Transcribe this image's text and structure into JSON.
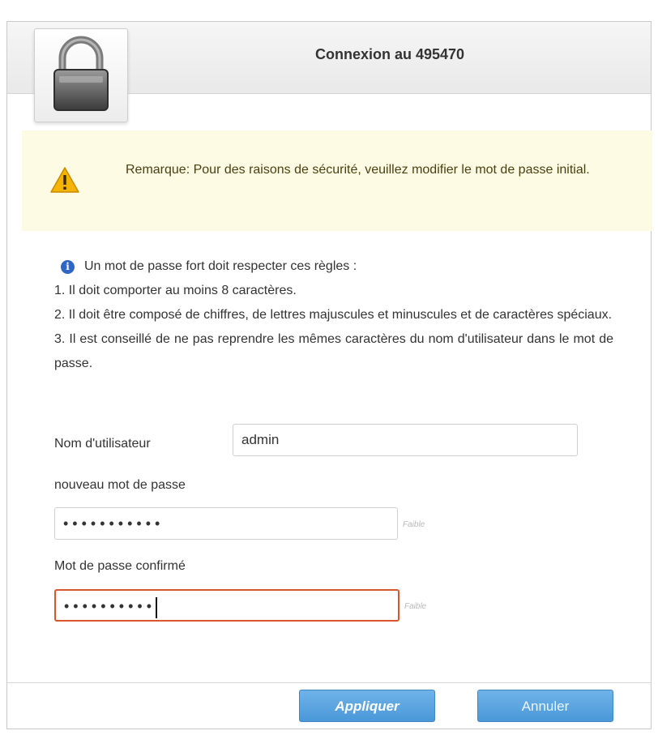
{
  "dialog": {
    "title": "Connexion au 495470"
  },
  "notice": {
    "text": "Remarque: Pour des raisons de sécurité, veuillez modifier le mot de passe initial."
  },
  "rules": {
    "intro": "Un mot de passe fort doit respecter ces règles :",
    "items": [
      "1. Il doit comporter au moins 8 caractères.",
      "2. Il doit être composé de chiffres, de lettres majuscules et minuscules et de caractères spéciaux.",
      "3. Il est conseillé de ne pas reprendre les mêmes caractères du nom d'utilisateur dans le mot de passe."
    ]
  },
  "form": {
    "username_label": "Nom d'utilisateur",
    "username_value": "admin",
    "new_password_label": "nouveau mot de passe",
    "new_password_value": "•••••••••••",
    "confirm_password_label": "Mot de passe confirmé",
    "confirm_password_value": "••••••••••",
    "strength_hint_1": "Faible",
    "strength_hint_2": "Faible"
  },
  "footer": {
    "apply_label": "Appliquer",
    "cancel_label": "Annuler"
  },
  "icons": {
    "lock": "lock-icon",
    "warning": "warning-icon",
    "info": "info-icon"
  },
  "colors": {
    "accent": "#4a98d8",
    "notice_bg": "#fdfbe3",
    "warning": "#f4b400",
    "error_border": "#d8572b"
  }
}
